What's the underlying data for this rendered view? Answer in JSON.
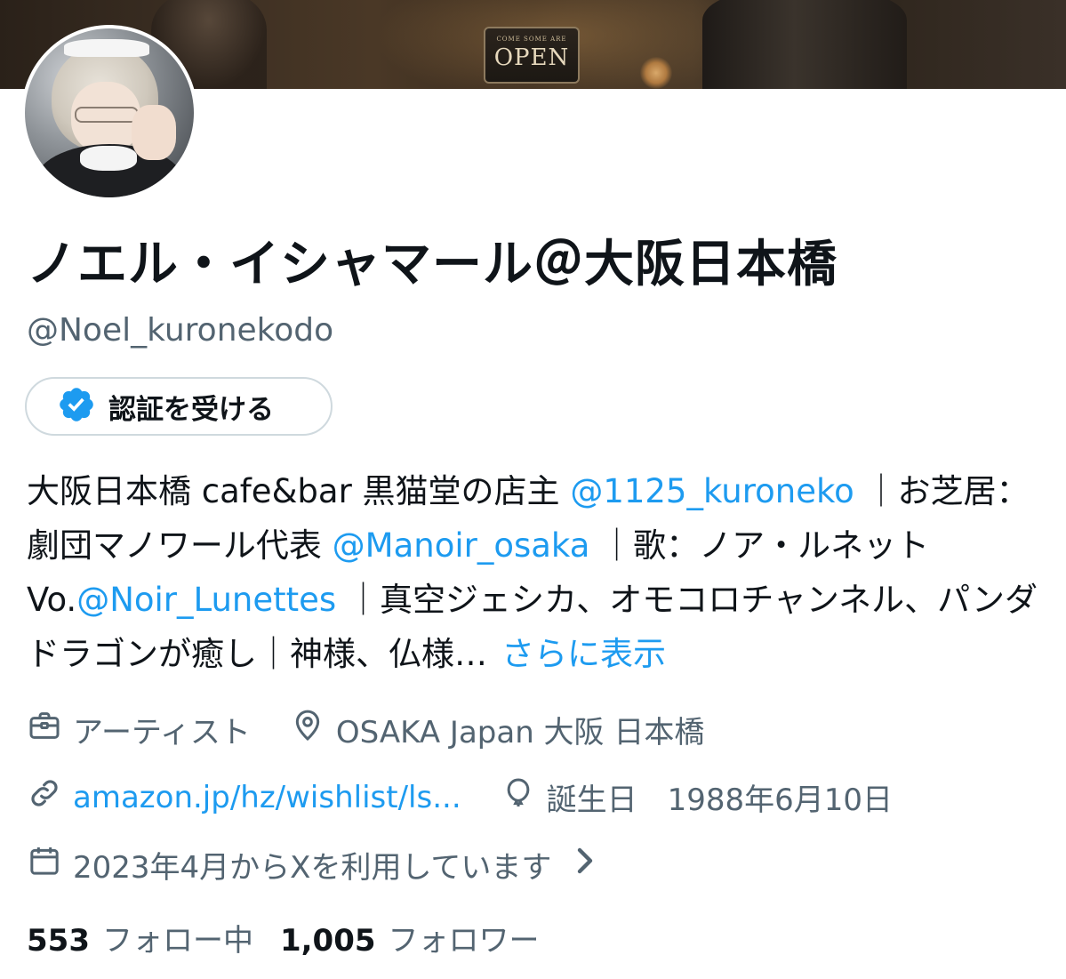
{
  "banner": {
    "sign_small": "COME SOME ARE",
    "sign_big": "OPEN"
  },
  "profile": {
    "display_name": "ノエル・イシャマール＠大阪日本橋",
    "handle": "@Noel_kuronekodo",
    "verify_label": "認証を受ける"
  },
  "bio": {
    "t1": "大阪日本橋 cafe&bar 黒猫堂の店主 ",
    "m1": "@1125_kuroneko",
    "t2": " ｜お芝居：劇団マノワール代表 ",
    "m2": "@Manoir_osaka",
    "t3": " ｜歌：ノア・ルネット Vo.",
    "m3": "@Noir_Lunettes",
    "t4": " ｜真空ジェシカ、オモコロチャンネル、パンダドラゴンが癒し｜神様、仏様…",
    "more": "さらに表示"
  },
  "meta": {
    "category": "アーティスト",
    "location": "OSAKA Japan 大阪 日本橋",
    "website": "amazon.jp/hz/wishlist/ls...",
    "birthday": "誕生日　1988年6月10日",
    "joined": "2023年4月からXを利用しています"
  },
  "follows": {
    "following_count": "553",
    "following_label": "フォロー中",
    "followers_count": "1,005",
    "followers_label": "フォロワー"
  },
  "colors": {
    "accent": "#1d9bf0",
    "secondary_text": "#536471",
    "primary_text": "#0f1419",
    "border": "#cfd9de"
  },
  "icons": {
    "verify": "verified-badge-icon",
    "category": "briefcase-icon",
    "location": "location-pin-icon",
    "website": "link-icon",
    "birthday": "balloon-icon",
    "joined": "calendar-icon",
    "chevron": "chevron-right-icon"
  }
}
